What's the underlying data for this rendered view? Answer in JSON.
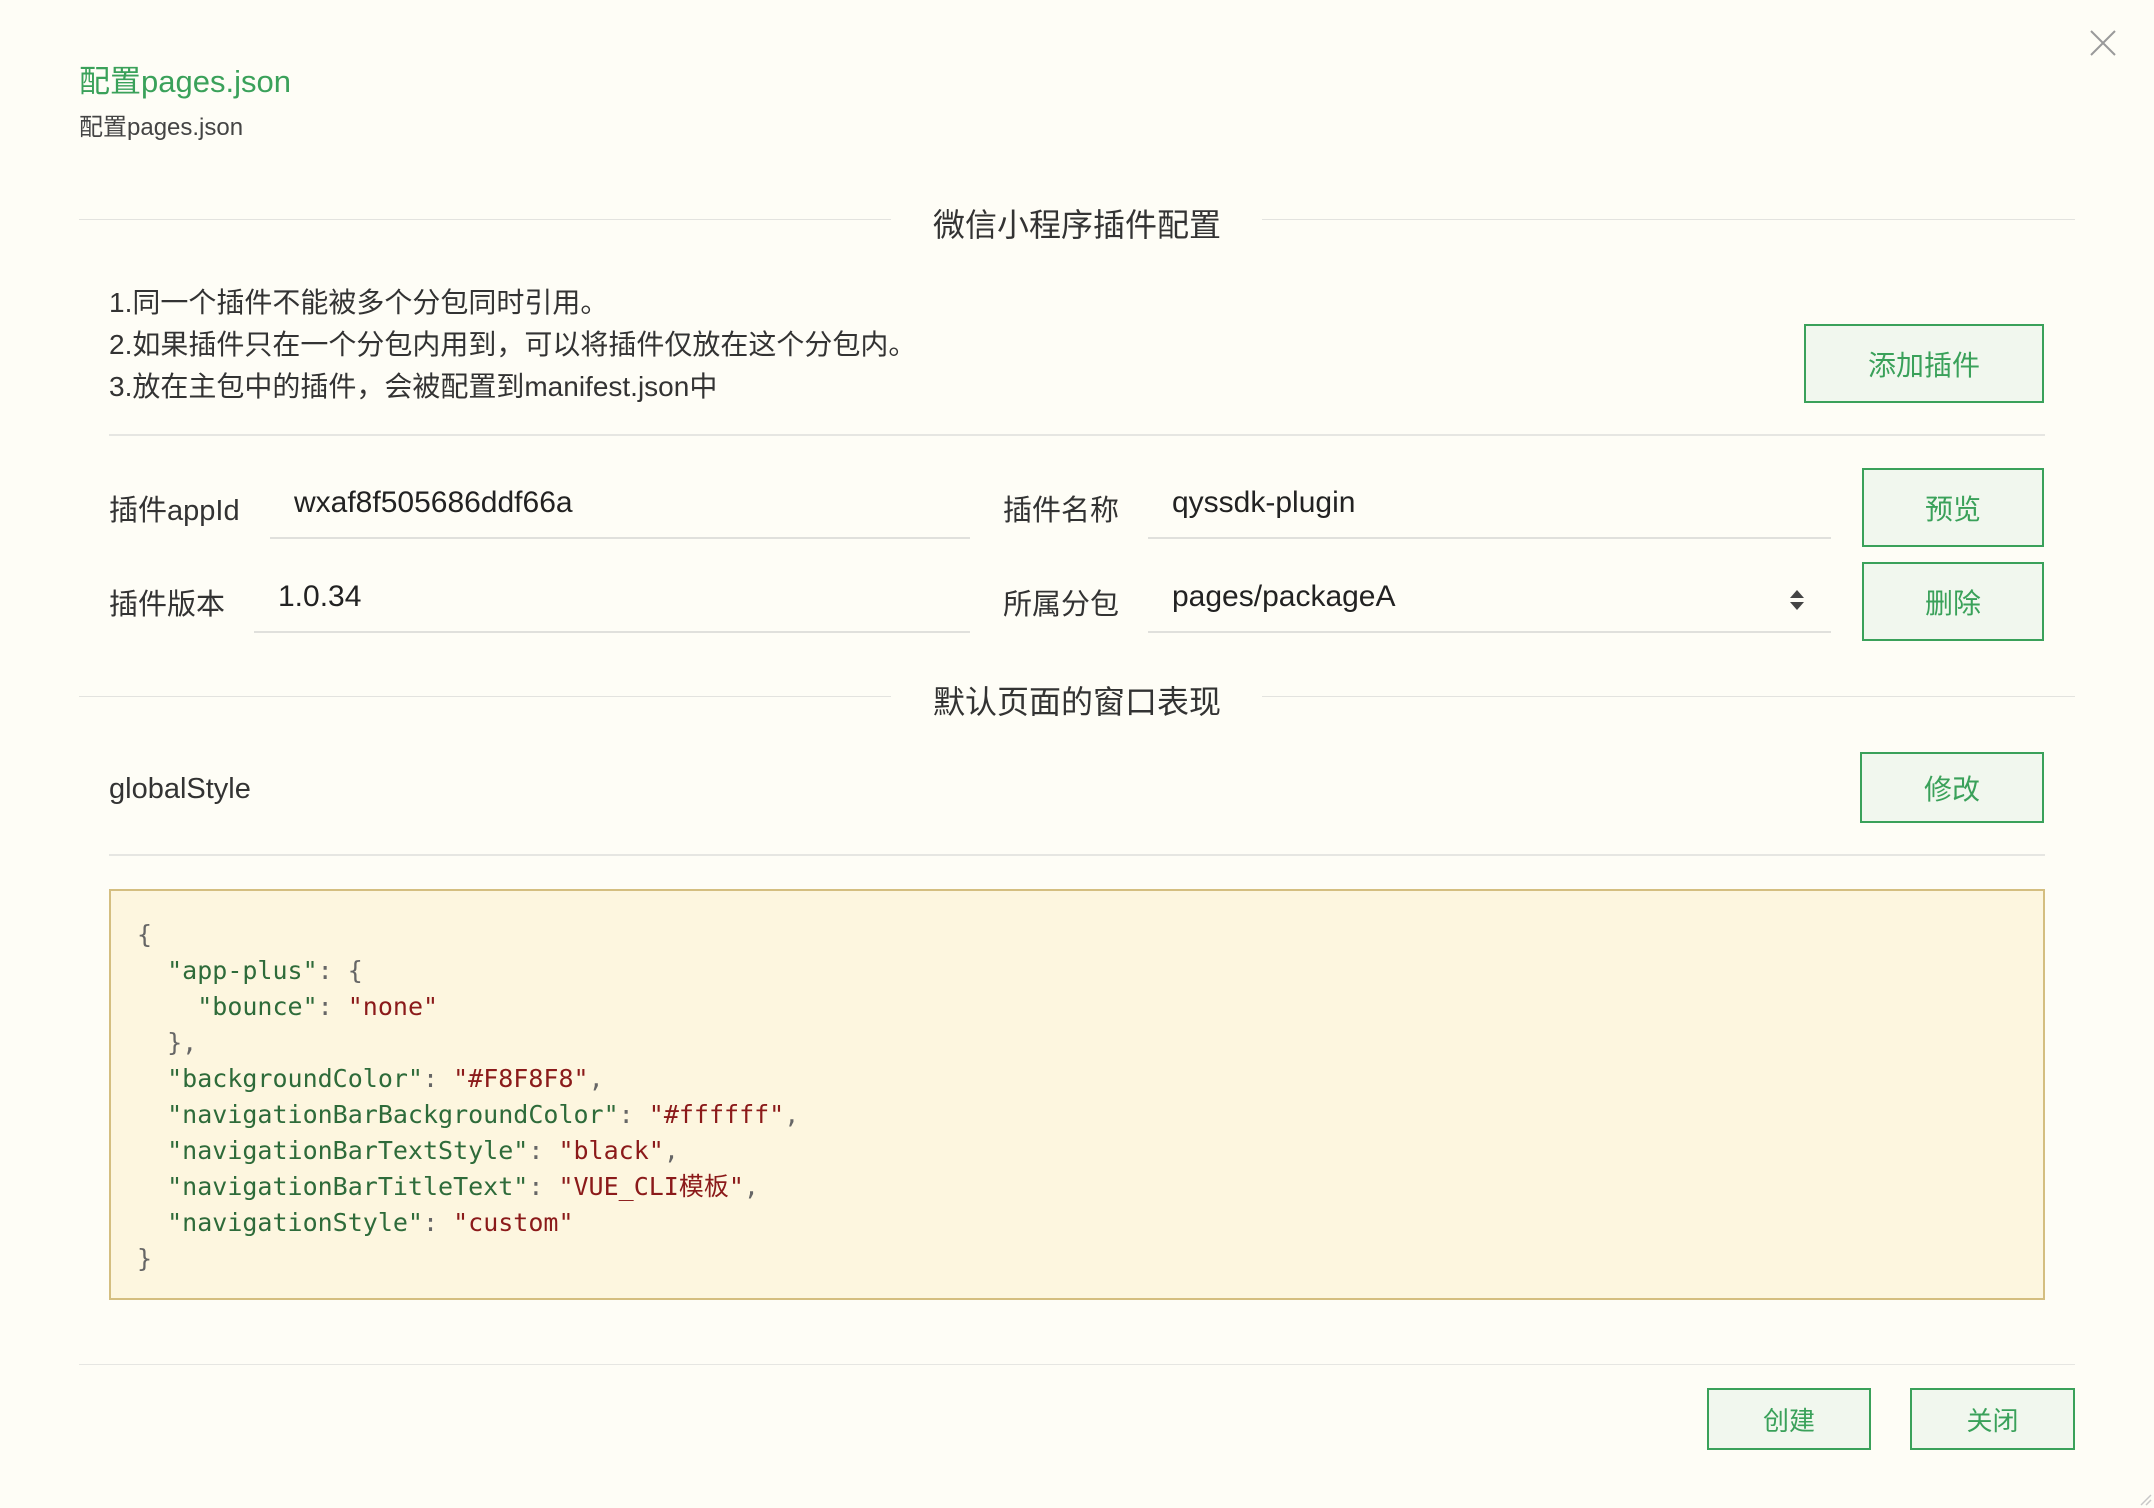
{
  "dialog": {
    "title": "配置pages.json",
    "subtitle": "配置pages.json"
  },
  "plugin_section": {
    "title": "微信小程序插件配置",
    "notes": [
      "1.同一个插件不能被多个分包同时引用。",
      "2.如果插件只在一个分包内用到，可以将插件仅放在这个分包内。",
      "3.放在主包中的插件，会被配置到manifest.json中"
    ],
    "add_button": "添加插件",
    "appid_label": "插件appId",
    "appid_value": "wxaf8f505686ddf66a",
    "name_label": "插件名称",
    "name_value": "qyssdk-plugin",
    "version_label": "插件版本",
    "version_value": "1.0.34",
    "package_label": "所属分包",
    "package_value": "pages/packageA",
    "preview_button": "预览",
    "delete_button": "删除"
  },
  "window_section": {
    "title": "默认页面的窗口表现",
    "global_style_label": "globalStyle",
    "edit_button": "修改",
    "code_lines": [
      {
        "k": "",
        "v": "",
        "text": "{"
      },
      {
        "k": "\"app-plus\"",
        "v": "",
        "text": ": {",
        "indent": 1
      },
      {
        "k": "\"bounce\"",
        "v": "\"none\"",
        "text": "",
        "indent": 2
      },
      {
        "k": "",
        "v": "",
        "text": "},",
        "indent": 1
      },
      {
        "k": "\"backgroundColor\"",
        "v": "\"#F8F8F8\"",
        "tail": ",",
        "indent": 1
      },
      {
        "k": "\"navigationBarBackgroundColor\"",
        "v": "\"#ffffff\"",
        "tail": ",",
        "indent": 1
      },
      {
        "k": "\"navigationBarTextStyle\"",
        "v": "\"black\"",
        "tail": ",",
        "indent": 1
      },
      {
        "k": "\"navigationBarTitleText\"",
        "v": "\"VUE_CLI模板\"",
        "tail": ",",
        "indent": 1
      },
      {
        "k": "\"navigationStyle\"",
        "v": "\"custom\"",
        "indent": 1
      },
      {
        "k": "",
        "v": "",
        "text": "}"
      }
    ]
  },
  "footer": {
    "create_button": "创建",
    "close_button": "关闭"
  },
  "colors": {
    "accent": "#3aa15a",
    "background": "#fefdf6",
    "code_bg": "#fdf6df",
    "code_border": "#d4be80",
    "string": "#8b1a1a"
  }
}
